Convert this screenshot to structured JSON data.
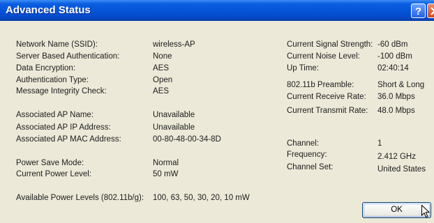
{
  "window": {
    "title": "Advanced Status"
  },
  "left_fields": [
    {
      "label": "Network Name (SSID):",
      "value": "wireless-AP"
    },
    {
      "label": "Server Based Authentication:",
      "value": "None"
    },
    {
      "label": "Data Encryption:",
      "value": "AES"
    },
    {
      "label": "Authentication Type:",
      "value": "Open"
    },
    {
      "label": "Message Integrity Check:",
      "value": "AES"
    },
    {
      "label": "Associated AP Name:",
      "value": "Unavailable"
    },
    {
      "label": "Associated AP IP Address:",
      "value": "Unavailable"
    },
    {
      "label": "Associated AP MAC Address:",
      "value": "00-80-48-00-34-8D"
    },
    {
      "label": "Power Save Mode:",
      "value": "Normal"
    },
    {
      "label": "Current Power Level:",
      "value": "50 mW"
    },
    {
      "label": "Available Power Levels (802.11b/g):",
      "value": "100, 63, 50, 30, 20, 10 mW"
    }
  ],
  "right_fields": [
    {
      "label": "Current Signal Strength:",
      "value": "-60 dBm"
    },
    {
      "label": "Current Noise Level:",
      "value": "-100 dBm"
    },
    {
      "label": "Up Time:",
      "value": "02:40:14"
    },
    {
      "label": "802.11b Preamble:",
      "value": "Short & Long"
    },
    {
      "label": "Current Receive Rate:",
      "value": "36.0 Mbps"
    },
    {
      "label": "Current Transmit Rate:",
      "value": "48.0 Mbps"
    },
    {
      "label": "Channel:",
      "value": "1"
    },
    {
      "label": "Frequency:",
      "value": "2.412 GHz"
    },
    {
      "label": "Channel Set:",
      "value": "United States"
    }
  ],
  "buttons": {
    "ok_label": "OK",
    "help_label": "?"
  }
}
